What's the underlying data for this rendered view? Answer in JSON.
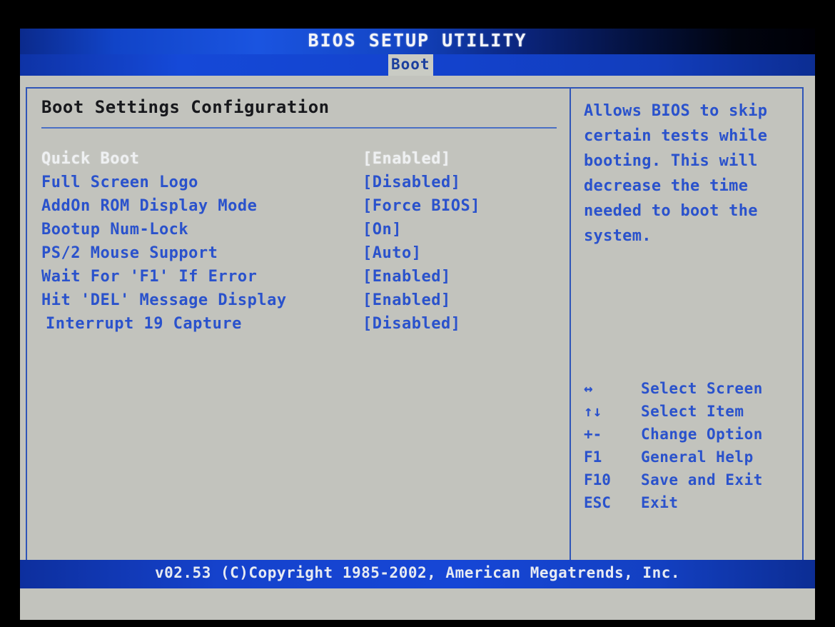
{
  "window": {
    "title": "BIOS SETUP UTILITY"
  },
  "tabs": [
    {
      "id": "boot",
      "label": "Boot",
      "active": true
    }
  ],
  "main": {
    "section_heading": "Boot Settings Configuration",
    "settings": [
      {
        "label": "Quick Boot",
        "value": "[Enabled]",
        "selected": true,
        "indent": false
      },
      {
        "label": "Full Screen Logo",
        "value": "[Disabled]",
        "selected": false,
        "indent": false
      },
      {
        "label": "AddOn ROM Display Mode",
        "value": "[Force BIOS]",
        "selected": false,
        "indent": false
      },
      {
        "label": "Bootup Num-Lock",
        "value": "[On]",
        "selected": false,
        "indent": false
      },
      {
        "label": "PS/2 Mouse Support",
        "value": "[Auto]",
        "selected": false,
        "indent": false
      },
      {
        "label": "Wait For 'F1' If Error",
        "value": "[Enabled]",
        "selected": false,
        "indent": false
      },
      {
        "label": "Hit 'DEL' Message Display",
        "value": "[Enabled]",
        "selected": false,
        "indent": false
      },
      {
        "label": "Interrupt 19 Capture",
        "value": "[Disabled]",
        "selected": false,
        "indent": true
      }
    ]
  },
  "help": {
    "text": "Allows BIOS to skip certain tests while booting. This will decrease the time needed to boot the system."
  },
  "nav_legend": [
    {
      "key": "↔",
      "key_name": "left-right-arrow",
      "desc": "Select Screen"
    },
    {
      "key": "↑↓",
      "key_name": "up-down-arrow",
      "desc": "Select Item"
    },
    {
      "key": "+-",
      "key_name": "plus-minus",
      "desc": "Change Option"
    },
    {
      "key": "F1",
      "key_name": "f1",
      "desc": "General Help"
    },
    {
      "key": "F10",
      "key_name": "f10",
      "desc": "Save and Exit"
    },
    {
      "key": "ESC",
      "key_name": "esc",
      "desc": "Exit"
    }
  ],
  "footer": {
    "text": "v02.53 (C)Copyright 1985-2002, American Megatrends, Inc."
  },
  "colors": {
    "panel_bg": "#c2c3bd",
    "accent_blue": "#2a52cc",
    "border_blue": "#2f55b8",
    "title_bar_blue": "#1544cc",
    "selected_text": "#eef0f2",
    "heading_text": "#17181c"
  }
}
